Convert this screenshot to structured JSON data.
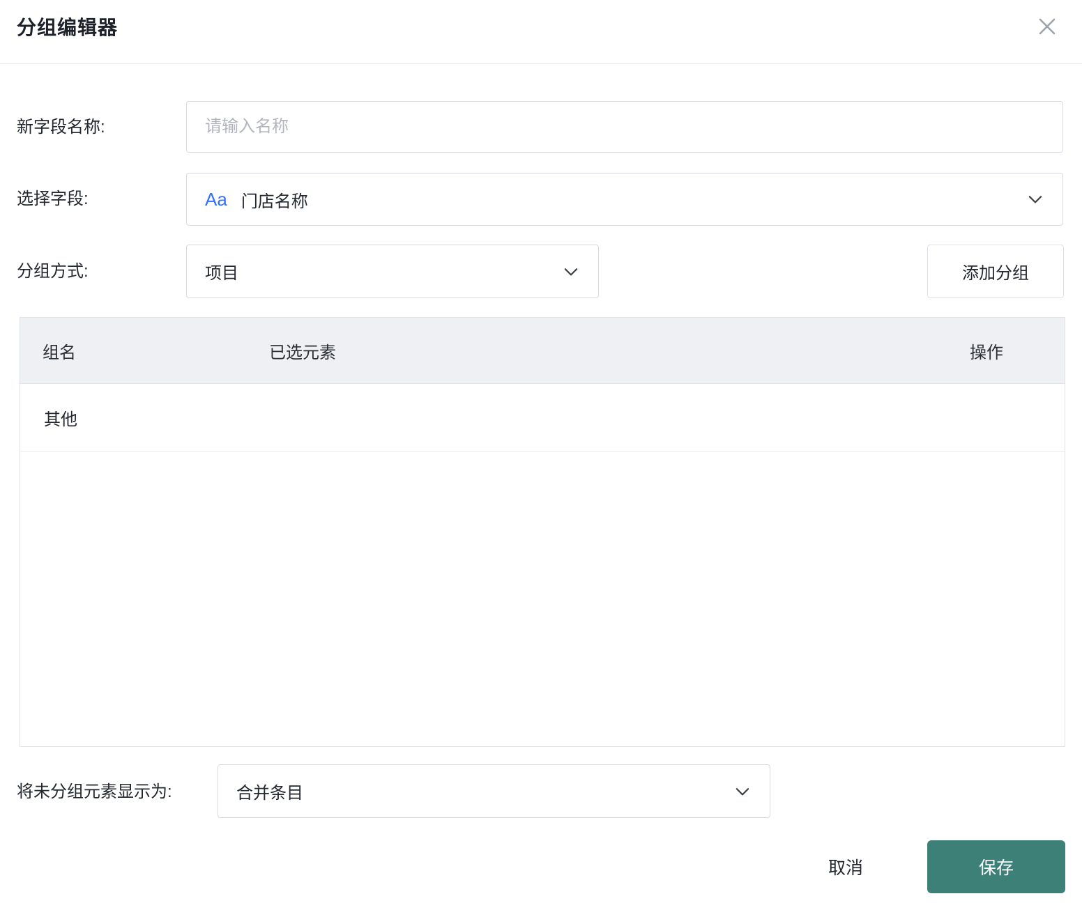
{
  "dialog": {
    "title": "分组编辑器"
  },
  "form": {
    "new_field_label": "新字段名称:",
    "new_field_placeholder": "请输入名称",
    "select_field_label": "选择字段:",
    "select_field_type_badge": "Aa",
    "select_field_value": "门店名称",
    "group_method_label": "分组方式:",
    "group_method_value": "项目",
    "add_group_button": "添加分组"
  },
  "table": {
    "headers": {
      "group_name": "组名",
      "selected_elements": "已选元素",
      "actions": "操作"
    },
    "rows": [
      {
        "group_name": "其他",
        "selected_elements": "",
        "actions": ""
      }
    ]
  },
  "ungrouped_display": {
    "label": "将未分组元素显示为:",
    "value": "合并条目"
  },
  "footer": {
    "cancel": "取消",
    "save": "保存"
  },
  "colors": {
    "accent": "#3d8077",
    "field_badge_blue": "#3370ff",
    "table_header_bg": "#eef0f4",
    "border": "#d6dae0"
  }
}
